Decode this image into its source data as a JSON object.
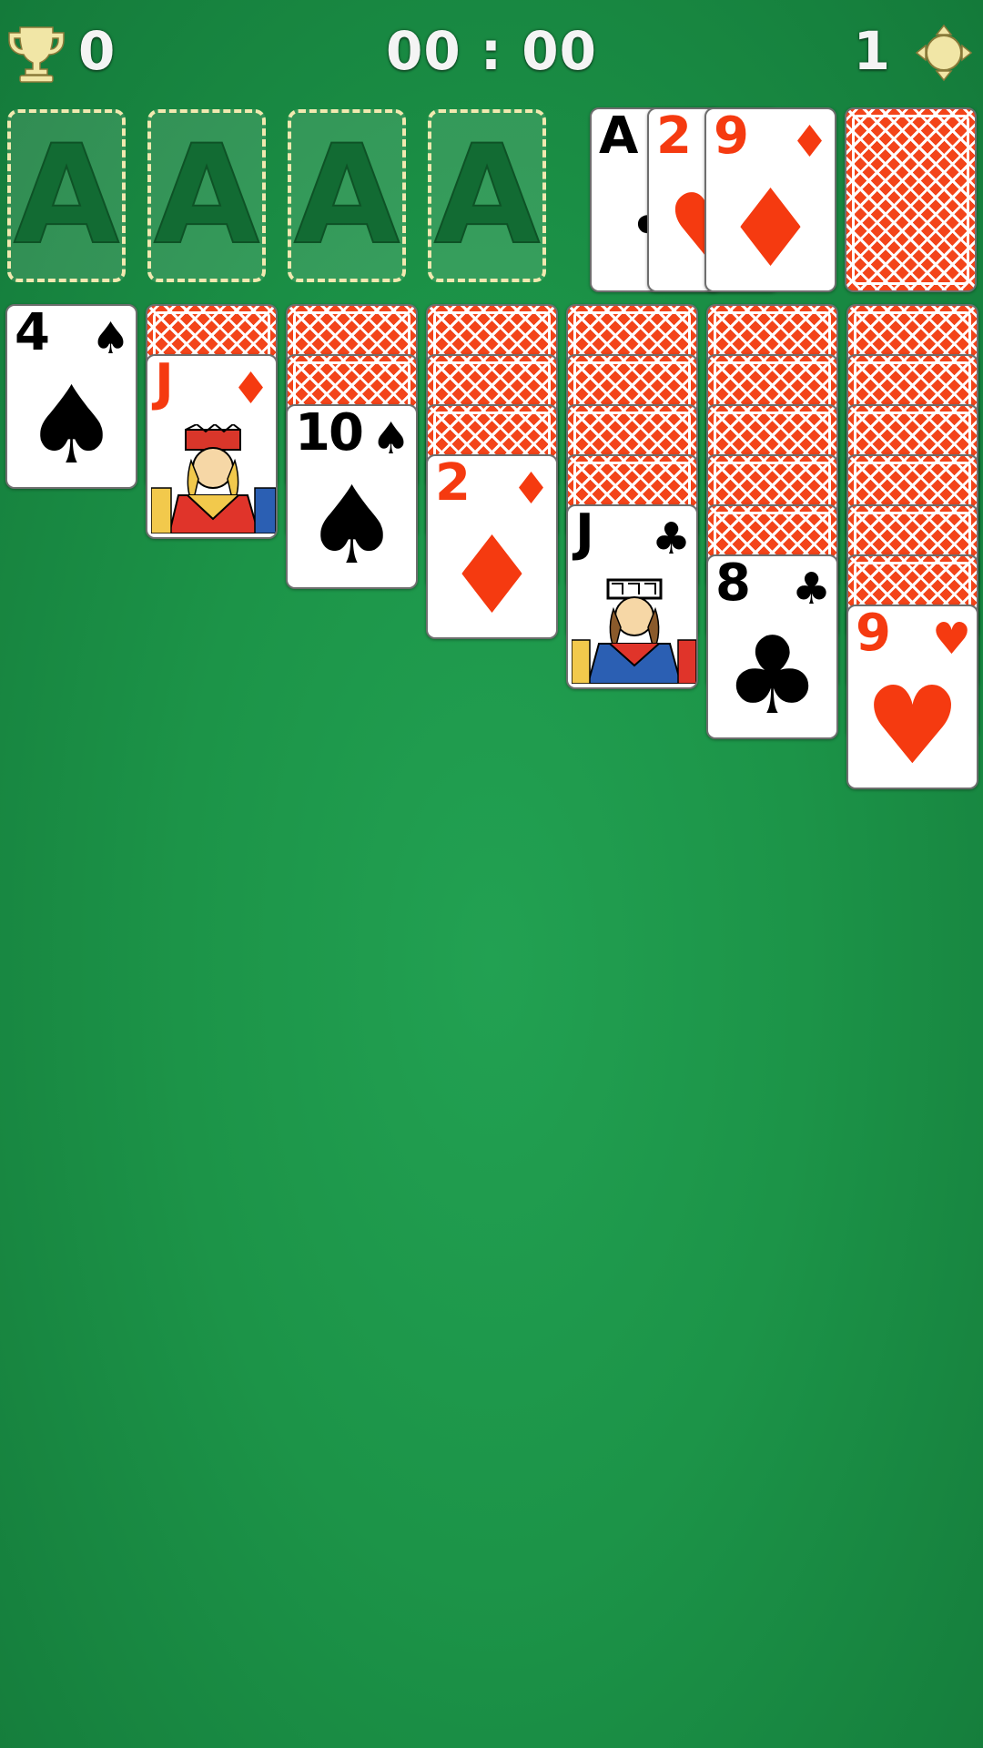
{
  "hud": {
    "score": "0",
    "timer": "00 : 00",
    "moves": "1",
    "trophy_icon": "trophy-icon",
    "settings_icon": "settings-icon"
  },
  "colors": {
    "felt": "#1c9448",
    "red_suit": "#f53a10",
    "card_back": "#f3441a",
    "slot_border": "#f2e9b0"
  },
  "foundations": [
    {
      "label": "A"
    },
    {
      "label": "A"
    },
    {
      "label": "A"
    },
    {
      "label": "A"
    }
  ],
  "waste": [
    {
      "rank": "A",
      "suit": "♣",
      "color": "black"
    },
    {
      "rank": "2",
      "suit": "♥",
      "color": "red"
    },
    {
      "rank": "9",
      "suit": "♦",
      "color": "red"
    }
  ],
  "stock": {
    "face_down": true
  },
  "tableau": [
    {
      "hidden": 0,
      "top": {
        "rank": "4",
        "suit": "♠",
        "color": "black",
        "face": false
      }
    },
    {
      "hidden": 1,
      "top": {
        "rank": "J",
        "suit": "♦",
        "color": "red",
        "face": true
      }
    },
    {
      "hidden": 2,
      "top": {
        "rank": "10",
        "suit": "♠",
        "color": "black",
        "face": false
      }
    },
    {
      "hidden": 3,
      "top": {
        "rank": "2",
        "suit": "♦",
        "color": "red",
        "face": false
      }
    },
    {
      "hidden": 4,
      "top": {
        "rank": "J",
        "suit": "♣",
        "color": "black",
        "face": true
      }
    },
    {
      "hidden": 5,
      "top": {
        "rank": "8",
        "suit": "♣",
        "color": "black",
        "face": false
      }
    },
    {
      "hidden": 6,
      "top": {
        "rank": "9",
        "suit": "♥",
        "color": "red",
        "face": false
      }
    }
  ]
}
